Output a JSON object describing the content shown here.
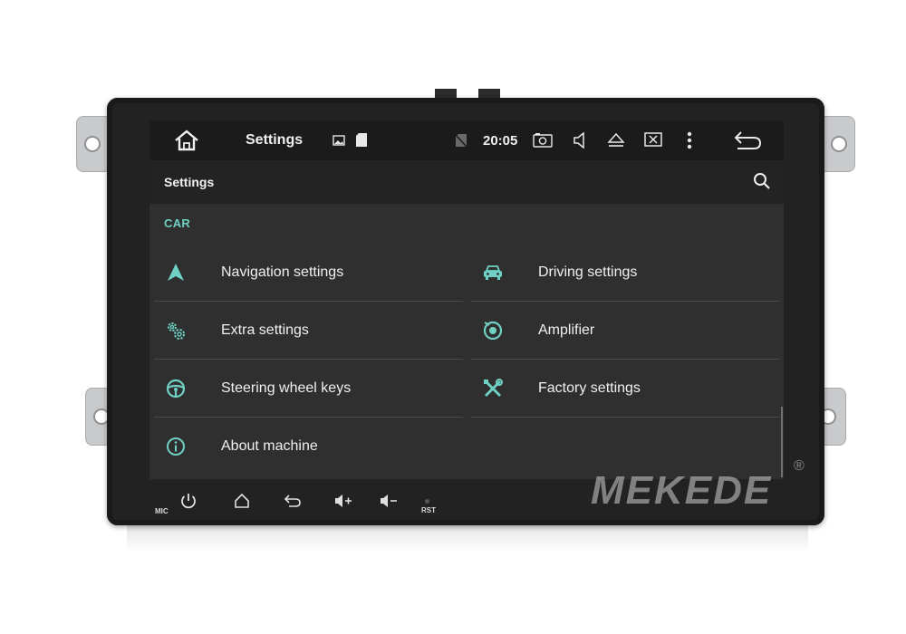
{
  "status_bar": {
    "title": "Settings",
    "clock": "20:05",
    "icons": [
      "home-icon",
      "image-icon",
      "sd-card-icon",
      "no-sim-icon",
      "camera-icon",
      "volume-icon",
      "eject-icon",
      "close-window-icon",
      "more-vert-icon",
      "back-icon"
    ]
  },
  "toolbar": {
    "title": "Settings",
    "search_icon": "search-icon"
  },
  "section": {
    "header": "CAR"
  },
  "items": [
    {
      "label": "Navigation settings",
      "icon": "navigation-arrow-icon"
    },
    {
      "label": "Driving settings",
      "icon": "car-icon"
    },
    {
      "label": "Extra settings",
      "icon": "gears-icon"
    },
    {
      "label": "Amplifier",
      "icon": "speaker-icon"
    },
    {
      "label": "Steering wheel keys",
      "icon": "steering-wheel-icon"
    },
    {
      "label": "Factory settings",
      "icon": "tools-icon"
    },
    {
      "label": "About machine",
      "icon": "info-icon"
    }
  ],
  "hardware": {
    "mic_label": "MIC",
    "rst_label": "RST",
    "buttons": [
      "power-icon",
      "home-icon",
      "back-icon",
      "volume-up-icon",
      "volume-down-icon"
    ]
  },
  "brand": {
    "name": "MEKEDE",
    "reg": "®"
  },
  "colors": {
    "accent": "#6fd0c3",
    "screen_bg": "#2f2f2f",
    "statusbar_bg": "#1b1b1b"
  }
}
